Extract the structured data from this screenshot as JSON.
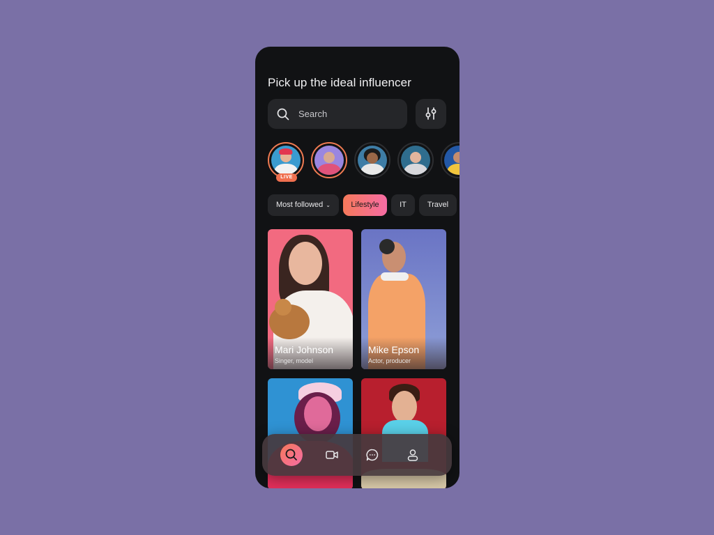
{
  "header": {
    "title": "Pick up the ideal influencer"
  },
  "search": {
    "placeholder": "Search",
    "icon": "search-icon"
  },
  "filter_button": {
    "icon": "sliders-icon"
  },
  "stories": [
    {
      "id": "story-1",
      "live": true,
      "live_label": "LIVE",
      "ring_color": "#f07b52"
    },
    {
      "id": "story-2",
      "live": false,
      "ring_color": "#f07b52"
    },
    {
      "id": "story-3",
      "live": false
    },
    {
      "id": "story-4",
      "live": false
    },
    {
      "id": "story-5",
      "live": false
    }
  ],
  "chips": [
    {
      "label": "Most followed",
      "has_dropdown": true,
      "active": false
    },
    {
      "label": "Lifestyle",
      "active": true
    },
    {
      "label": "IT",
      "active": false
    },
    {
      "label": "Travel",
      "active": false
    }
  ],
  "cards": [
    {
      "name": "Mari Johnson",
      "role": "Singer, model"
    },
    {
      "name": "Mike Epson",
      "role": "Actor, producer"
    },
    {
      "name": "",
      "role": ""
    },
    {
      "name": "",
      "role": ""
    }
  ],
  "bottom_nav": [
    {
      "icon": "search-icon",
      "active": true
    },
    {
      "icon": "video-icon",
      "active": false
    },
    {
      "icon": "chat-icon",
      "active": false
    },
    {
      "icon": "profile-icon",
      "active": false
    }
  ],
  "colors": {
    "background": "#7a70a6",
    "phone": "#111214",
    "accent_start": "#f5795a",
    "accent_end": "#f66ca4"
  }
}
